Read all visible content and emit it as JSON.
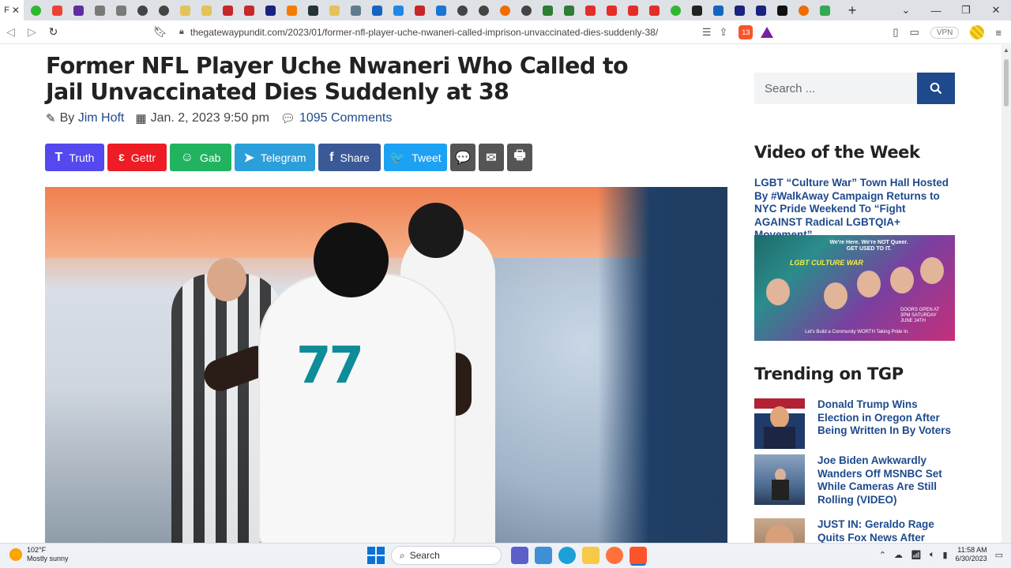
{
  "browser": {
    "active_tab_label": "F",
    "tab_icons": [
      {
        "name": "play-icon",
        "color": "#2eb82e"
      },
      {
        "name": "gmail-icon",
        "color": "#ea4335"
      },
      {
        "name": "mail-icon",
        "color": "#5f2da0"
      },
      {
        "name": "rumble-icon",
        "color": "#7a7a7a"
      },
      {
        "name": "rumble-icon",
        "color": "#7a7a7a"
      },
      {
        "name": "globe-icon",
        "color": "#444444"
      },
      {
        "name": "globe-icon",
        "color": "#444444"
      },
      {
        "name": "key-icon",
        "color": "#e2c35a"
      },
      {
        "name": "key-icon",
        "color": "#e2c35a"
      },
      {
        "name": "flag-icon",
        "color": "#c62828"
      },
      {
        "name": "flag-icon",
        "color": "#c62828"
      },
      {
        "name": "square-icon",
        "color": "#1a237e"
      },
      {
        "name": "ruler-icon",
        "color": "#f57c00"
      },
      {
        "name": "square-icon",
        "color": "#263238"
      },
      {
        "name": "key-icon",
        "color": "#e2c35a"
      },
      {
        "name": "pen-icon",
        "color": "#607d8b"
      },
      {
        "name": "news-icon",
        "color": "#1565c0"
      },
      {
        "name": "hat-icon",
        "color": "#1e88e5"
      },
      {
        "name": "shield-icon",
        "color": "#c62828"
      },
      {
        "name": "bag-icon",
        "color": "#1976d2"
      },
      {
        "name": "globe-icon",
        "color": "#444444"
      },
      {
        "name": "globe-icon",
        "color": "#444444"
      },
      {
        "name": "d-icon",
        "color": "#ef6c00"
      },
      {
        "name": "globe-icon",
        "color": "#444444"
      },
      {
        "name": "dash-icon",
        "color": "#2e7d32"
      },
      {
        "name": "dash-icon",
        "color": "#2e7d32"
      },
      {
        "name": "youtube-icon",
        "color": "#e52d27"
      },
      {
        "name": "youtube-icon",
        "color": "#e52d27"
      },
      {
        "name": "youtube-icon",
        "color": "#e52d27"
      },
      {
        "name": "youtube-icon",
        "color": "#e52d27"
      },
      {
        "name": "play-icon",
        "color": "#2eb82e"
      },
      {
        "name": "amazon-icon",
        "color": "#222222"
      },
      {
        "name": "lm-icon",
        "color": "#1565c0"
      },
      {
        "name": "nm-icon",
        "color": "#1a237e"
      },
      {
        "name": "nm-icon",
        "color": "#1a237e"
      },
      {
        "name": "m-icon",
        "color": "#111111"
      },
      {
        "name": "d-icon",
        "color": "#ef6c00"
      },
      {
        "name": "maps-icon",
        "color": "#34a853"
      }
    ],
    "url": "thegatewaypundit.com/2023/01/former-nfl-player-uche-nwaneri-called-imprison-unvaccinated-dies-suddenly-38/",
    "brave_badge": "13",
    "vpn_label": "VPN"
  },
  "article": {
    "title": "Former NFL Player Uche Nwaneri Who Called to Jail Unvaccinated Dies Suddenly at 38",
    "by_label": "By",
    "author": "Jim Hoft",
    "date": "Jan. 2, 2023 9:50 pm",
    "comments": "1095 Comments",
    "hero_jersey_number": "77"
  },
  "share_buttons": [
    {
      "label": "Truth",
      "glyph": "T",
      "color": "#5448ee",
      "width": 75
    },
    {
      "label": "Gettr",
      "glyph": "ɛ",
      "color": "#ee1c25",
      "width": 75
    },
    {
      "label": "Gab",
      "glyph": "☺",
      "color": "#21b35f",
      "width": 78
    },
    {
      "label": "Telegram",
      "glyph": "➤",
      "color": "#2c9ed9",
      "width": 102
    },
    {
      "label": "Share",
      "glyph": "f",
      "color": "#3b5997",
      "width": 79
    },
    {
      "label": "Tweet",
      "glyph": "🐦",
      "color": "#1da1f2",
      "width": 80
    },
    {
      "label": "",
      "glyph": "💬",
      "color": "#555555",
      "width": 32
    },
    {
      "label": "",
      "glyph": "✉",
      "color": "#555555",
      "width": 32
    },
    {
      "label": "",
      "glyph": "🖶",
      "color": "#555555",
      "width": 32
    }
  ],
  "sidebar": {
    "search_placeholder": "Search ...",
    "video_heading": "Video of the Week",
    "video_title": "LGBT “Culture War” Town Hall Hosted By #WalkAway Campaign Returns to NYC Pride Weekend To “Fight AGAINST Radical LGBTQIA+ Movement”",
    "video_thumb_text": {
      "top": "We're Here. We're NOT Queer. GET USED TO IT.",
      "title": "LGBT CULTURE WAR",
      "doors": "DOORS OPEN AT 3PM SATURDAY JUNE 24TH",
      "bottom": "Let's Build a Community WORTH Taking Pride In."
    },
    "trending_heading": "Trending on TGP",
    "trending": [
      {
        "title": "Donald Trump Wins Election in Oregon After Being Written In By Voters"
      },
      {
        "title": "Joe Biden Awkwardly Wanders Off MSNBC Set While Cameras Are Still Rolling (VIDEO)"
      },
      {
        "title": "JUST IN: Geraldo Rage Quits Fox News After"
      }
    ]
  },
  "taskbar": {
    "temperature": "102°F",
    "weather": "Mostly sunny",
    "search_label": "Search",
    "time": "11:58 AM",
    "date": "6/30/2023"
  }
}
